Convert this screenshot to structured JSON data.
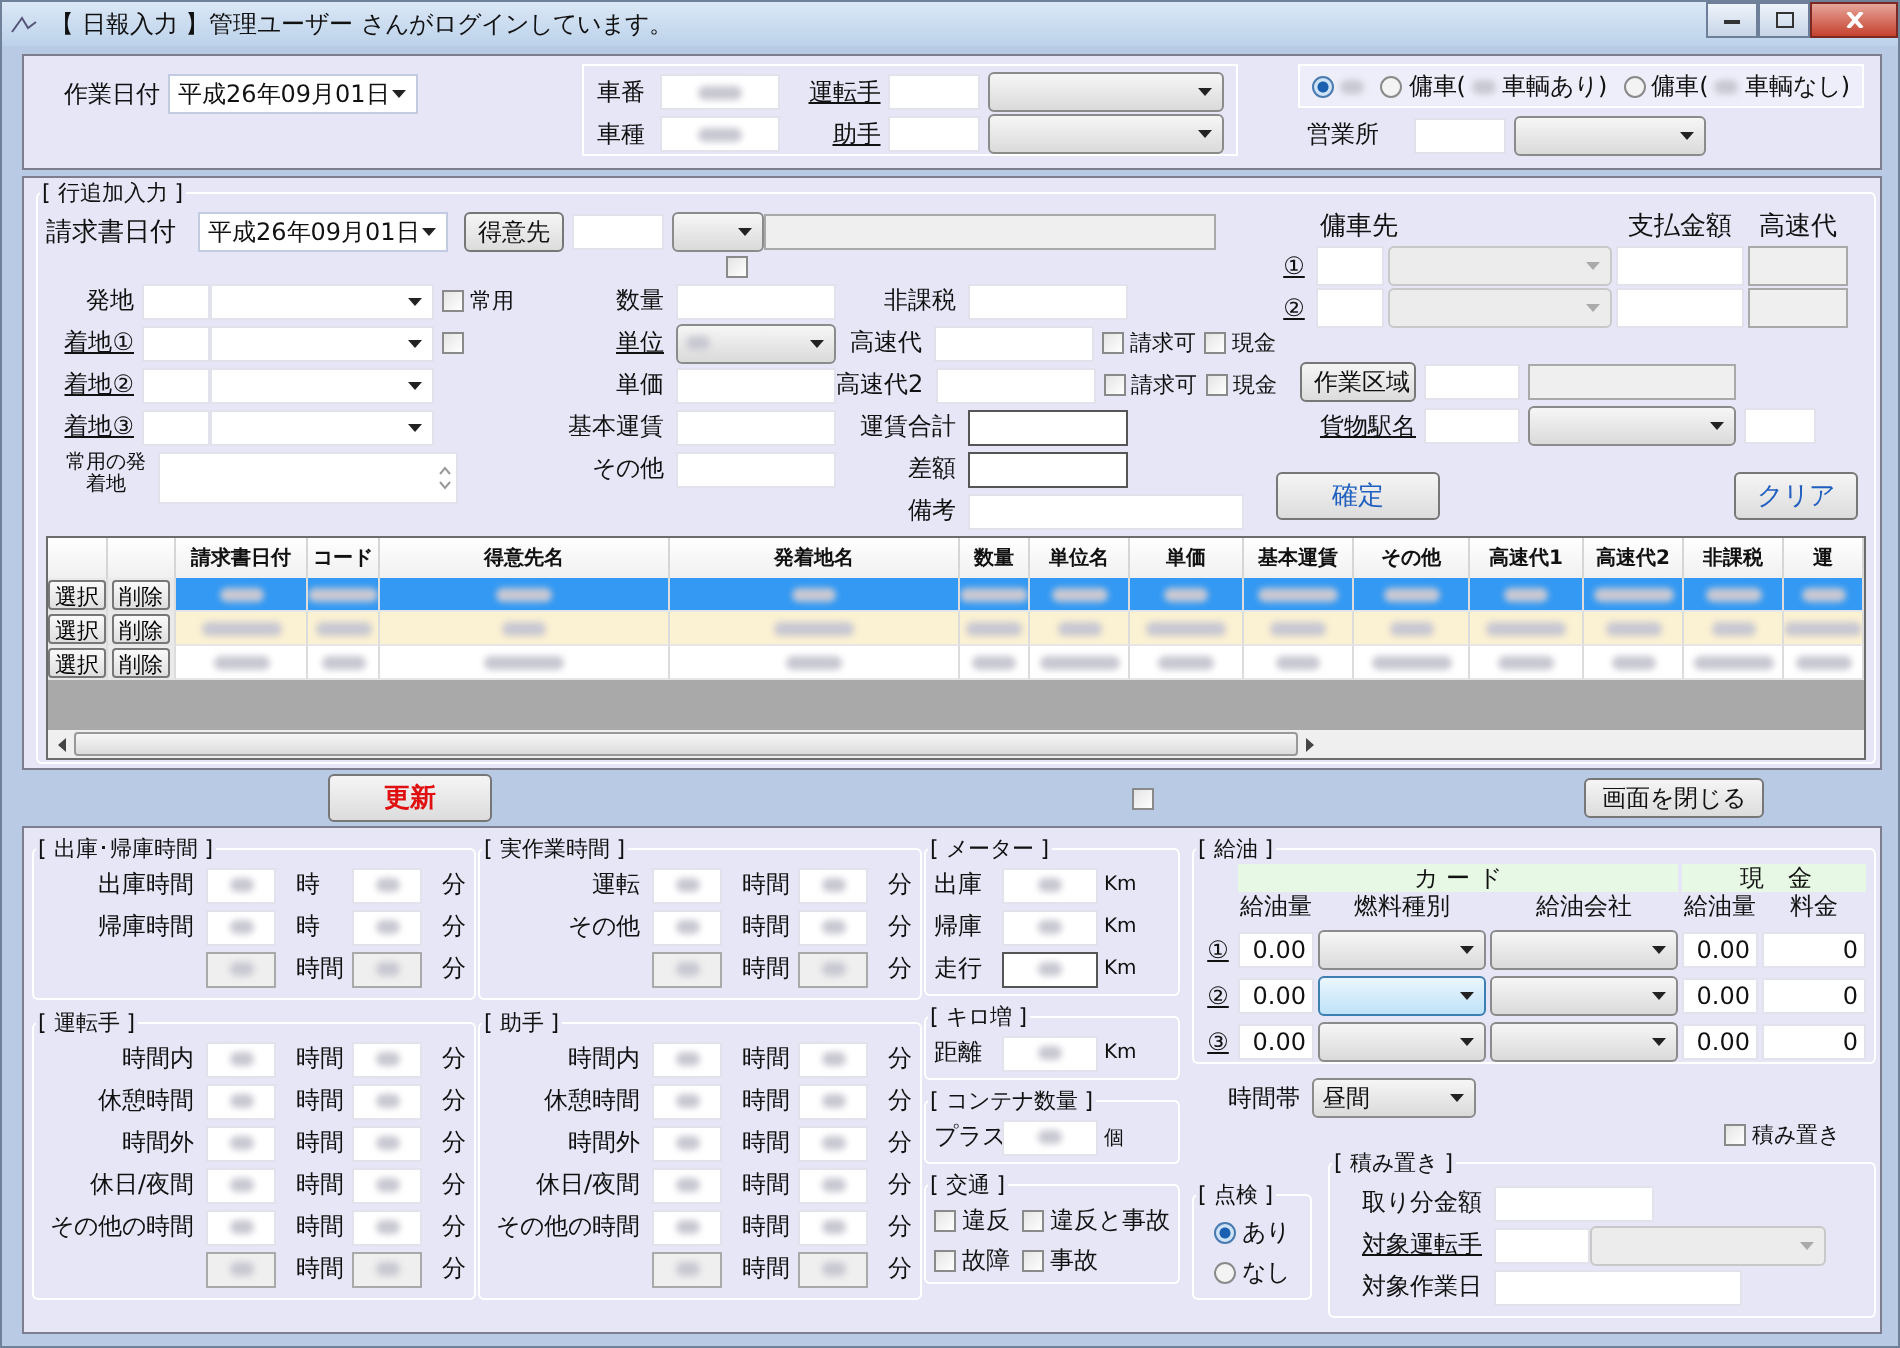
{
  "window": {
    "title": "【 日報入力 】管理ユーザー さんがログインしています。"
  },
  "header": {
    "work_date": {
      "label": "作業日付",
      "value": "平成26年09月01日"
    },
    "vehicle_labels": [
      "車番",
      "車種"
    ],
    "staff_links": [
      "運転手",
      "助手"
    ],
    "charter_options": [
      {
        "selected": true
      },
      {
        "prefix": "傭車(",
        "suffix": "車輌あり)",
        "selected": false
      },
      {
        "prefix": "傭車(",
        "suffix": "車輌なし)",
        "selected": false
      }
    ],
    "office_label": "営業所"
  },
  "entry": {
    "title": "[ 行追加入力 ]",
    "invoice_date": {
      "label": "請求書日付",
      "value": "平成26年09月01日"
    },
    "customer_button": "得意先",
    "customer_check": {
      "checked": false
    },
    "places": [
      {
        "label": "発地",
        "link": false,
        "check": {
          "label": "常用",
          "checked": false
        }
      },
      {
        "label": "着地①",
        "link": true,
        "check": {
          "checked": false
        }
      },
      {
        "label": "着地②",
        "link": true
      },
      {
        "label": "着地③",
        "link": true
      }
    ],
    "common_place_label": "常用の発着地",
    "amounts": [
      {
        "label": "数量",
        "link": false,
        "kind": "field"
      },
      {
        "label": "単位",
        "link": true,
        "kind": "combo"
      },
      {
        "label": "単価",
        "link": false,
        "kind": "field"
      },
      {
        "label": "基本運賃",
        "link": false,
        "kind": "field"
      },
      {
        "label": "その他",
        "link": false,
        "kind": "field"
      }
    ],
    "charges": [
      {
        "label": "非課税",
        "kind": "field"
      },
      {
        "label": "高速代",
        "kind": "field",
        "checks": [
          {
            "label": "請求可",
            "checked": false
          },
          {
            "label": "現金",
            "checked": false
          }
        ]
      },
      {
        "label": "高速代2",
        "kind": "field",
        "checks": [
          {
            "label": "請求可",
            "checked": false
          },
          {
            "label": "現金",
            "checked": false
          }
        ]
      },
      {
        "label": "運賃合計",
        "kind": "total"
      },
      {
        "label": "差額",
        "kind": "total"
      },
      {
        "label": "備考",
        "kind": "note"
      }
    ],
    "charter": {
      "headers": [
        "傭車先",
        "支払金額",
        "高速代"
      ],
      "rows": [
        "①",
        "②"
      ]
    },
    "work_area_button": "作業区域",
    "station_link": "貨物駅名",
    "confirm_button": "確定",
    "clear_button": "クリア"
  },
  "table": {
    "columns": [
      "請求書日付",
      "コード",
      "得意先名",
      "発着地名",
      "数量",
      "単位名",
      "単価",
      "基本運賃",
      "その他",
      "高速代1",
      "高速代2",
      "非課税",
      "運"
    ],
    "rows": [
      {
        "buttons": [
          "選択",
          "削除"
        ],
        "selected": true,
        "highlighted": false
      },
      {
        "buttons": [
          "選択",
          "削除"
        ],
        "selected": false,
        "highlighted": true
      },
      {
        "buttons": [
          "選択",
          "削除"
        ],
        "selected": false,
        "highlighted": false
      }
    ]
  },
  "actions": {
    "update_button": "更新",
    "check": {
      "checked": false
    },
    "close_button": "画面を閉じる"
  },
  "time_groups": [
    {
      "title": "[ 出庫･帰庫時間 ]",
      "rows": [
        {
          "label": "出庫時間",
          "units": [
            "時",
            "分"
          ],
          "kind": "input"
        },
        {
          "label": "帰庫時間",
          "units": [
            "時",
            "分"
          ],
          "kind": "input"
        },
        {
          "units": [
            "時間",
            "分"
          ],
          "kind": "total"
        }
      ]
    },
    {
      "title": "[ 実作業時間 ]",
      "rows": [
        {
          "label": "運転",
          "units": [
            "時間",
            "分"
          ],
          "kind": "input"
        },
        {
          "label": "その他",
          "units": [
            "時間",
            "分"
          ],
          "kind": "input"
        },
        {
          "units": [
            "時間",
            "分"
          ],
          "kind": "total"
        }
      ]
    },
    {
      "title": "[ 運転手 ]",
      "rows": [
        {
          "label": "時間内",
          "units": [
            "時間",
            "分"
          ],
          "kind": "input"
        },
        {
          "label": "休憩時間",
          "units": [
            "時間",
            "分"
          ],
          "kind": "input"
        },
        {
          "label": "時間外",
          "units": [
            "時間",
            "分"
          ],
          "kind": "input"
        },
        {
          "label": "休日/夜間",
          "units": [
            "時間",
            "分"
          ],
          "kind": "input"
        },
        {
          "label": "その他の時間",
          "units": [
            "時間",
            "分"
          ],
          "kind": "input"
        },
        {
          "units": [
            "時間",
            "分"
          ],
          "kind": "total"
        }
      ]
    },
    {
      "title": "[ 助手 ]",
      "rows": [
        {
          "label": "時間内",
          "units": [
            "時間",
            "分"
          ],
          "kind": "input"
        },
        {
          "label": "休憩時間",
          "units": [
            "時間",
            "分"
          ],
          "kind": "input"
        },
        {
          "label": "時間外",
          "units": [
            "時間",
            "分"
          ],
          "kind": "input"
        },
        {
          "label": "休日/夜間",
          "units": [
            "時間",
            "分"
          ],
          "kind": "input"
        },
        {
          "label": "その他の時間",
          "units": [
            "時間",
            "分"
          ],
          "kind": "input"
        },
        {
          "units": [
            "時間",
            "分"
          ],
          "kind": "total"
        }
      ]
    }
  ],
  "small_groups": [
    {
      "title": "[ メーター ]",
      "rows": [
        {
          "label": "出庫",
          "unit": "Km",
          "kind": "input"
        },
        {
          "label": "帰庫",
          "unit": "Km",
          "kind": "input"
        },
        {
          "label": "走行",
          "unit": "Km",
          "kind": "total"
        }
      ]
    },
    {
      "title": "[ キロ増 ]",
      "rows": [
        {
          "label": "距離",
          "unit": "Km",
          "kind": "input"
        }
      ]
    },
    {
      "title": "[ コンテナ数量 ]",
      "rows": [
        {
          "label": "プラス",
          "unit": "個",
          "kind": "input"
        }
      ]
    }
  ],
  "traffic": {
    "title": "[ 交通 ]",
    "items": [
      {
        "label": "違反",
        "checked": false
      },
      {
        "label": "違反と事故",
        "checked": false
      },
      {
        "label": "故障",
        "checked": false
      },
      {
        "label": "事故",
        "checked": false
      }
    ]
  },
  "inspection": {
    "title": "[ 点検 ]",
    "options": [
      {
        "label": "あり",
        "selected": true
      },
      {
        "label": "なし",
        "selected": false
      }
    ]
  },
  "fuel": {
    "title": "[ 給油 ]",
    "card_header": "カ ー ド",
    "cash_header": "現　金",
    "columns": [
      "給油量",
      "燃料種別",
      "給油会社",
      "給油量",
      "料金"
    ],
    "rows": [
      {
        "number": "①",
        "card_qty": "0.00",
        "cash_qty": "0.00",
        "fee": "0",
        "focused": false
      },
      {
        "number": "②",
        "card_qty": "0.00",
        "cash_qty": "0.00",
        "fee": "0",
        "focused": true
      },
      {
        "number": "③",
        "card_qty": "0.00",
        "cash_qty": "0.00",
        "fee": "0",
        "focused": false
      }
    ]
  },
  "time_zone": {
    "label": "時間帯",
    "value": "昼間"
  },
  "stacking": {
    "check": {
      "label": "積み置き",
      "checked": false
    },
    "title": "[ 積み置き ]",
    "share_label": "取り分金額",
    "driver_link": "対象運転手",
    "date_label": "対象作業日"
  }
}
